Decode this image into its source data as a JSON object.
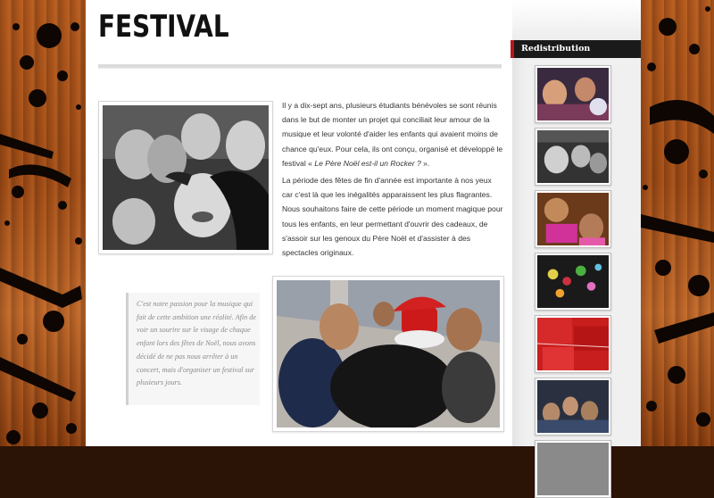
{
  "page": {
    "title": "FESTIVAL"
  },
  "content": {
    "paragraph1_part1": "Il y a dix-sept ans, plusieurs étudiants bénévoles se sont réunis dans le but de monter un projet qui conciliait leur amour de la musique et leur volonté d'aider les enfants qui avaient moins de chance qu'eux. Pour cela, ils ont conçu, organisé et développé le festival « ",
    "paragraph1_emph": "Le Père Noël est-il un Rocker ?",
    "paragraph1_part2": " ».",
    "paragraph2": "La période des fêtes de fin d'année est importante à nos yeux car c'est là que les inégalités apparaissent les plus flagrantes. Nous souhaitons faire de cette période un moment magique pour tous les enfants, en leur permettant d'ouvrir des cadeaux, de s'assoir sur les genoux du Père Noël et d'assister à des spectacles originaux.",
    "quote": "C'est notre passion pour la musique qui fait de cette ambition une réalité. Afin de voir un sourire sur le visage de chaque enfant lors des fêtes de Noël, nous avons décidé de ne pas nous arrêter à un concert, mais d'organiser un festival sur plusieurs jours."
  },
  "sidebar": {
    "heading": "Redistribution",
    "thumbnails": [
      {
        "name": "redistribution-photo-1"
      },
      {
        "name": "redistribution-photo-2"
      },
      {
        "name": "redistribution-photo-3"
      },
      {
        "name": "redistribution-photo-4"
      },
      {
        "name": "redistribution-photo-5"
      },
      {
        "name": "redistribution-photo-6"
      },
      {
        "name": "redistribution-photo-7"
      }
    ]
  },
  "colors": {
    "accent": "#c0141b",
    "heading_bg": "#1a1a1a",
    "wood": "#b65a1d"
  }
}
